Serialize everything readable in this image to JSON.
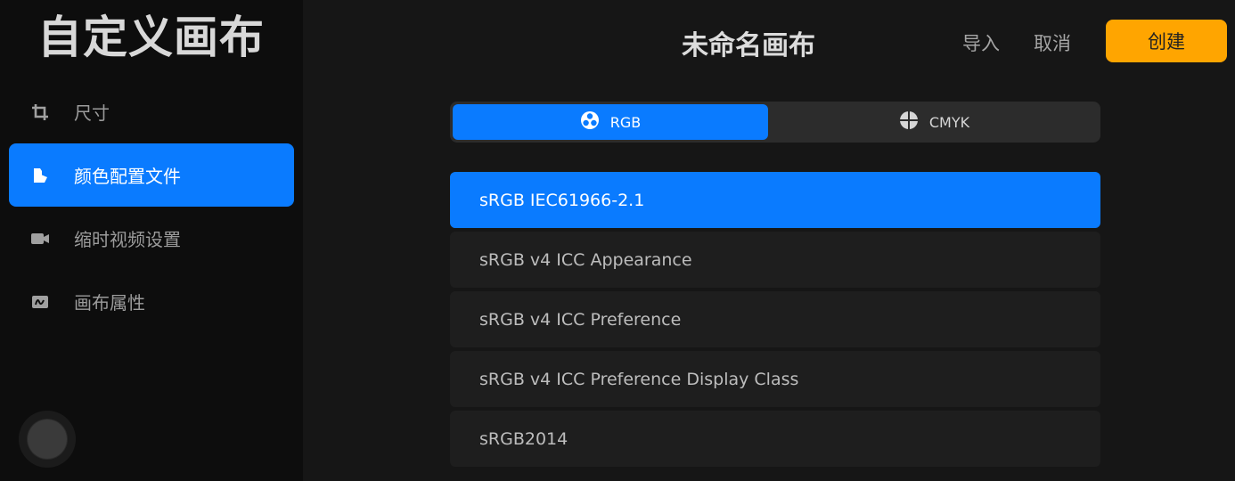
{
  "sidebar": {
    "title": "自定义画布",
    "items": [
      {
        "label": "尺寸",
        "icon": "crop-icon",
        "active": false
      },
      {
        "label": "颜色配置文件",
        "icon": "color-profile-icon",
        "active": true
      },
      {
        "label": "缩时视频设置",
        "icon": "video-camera-icon",
        "active": false
      },
      {
        "label": "画布属性",
        "icon": "canvas-properties-icon",
        "active": false
      }
    ]
  },
  "header": {
    "canvas_title": "未命名画布",
    "import_label": "导入",
    "cancel_label": "取消",
    "create_label": "创建"
  },
  "color_mode": {
    "selected": "RGB",
    "options": [
      {
        "label": "RGB",
        "icon": "rgb-icon"
      },
      {
        "label": "CMYK",
        "icon": "cmyk-icon"
      }
    ]
  },
  "profiles": {
    "selected_index": 0,
    "items": [
      "sRGB IEC61966-2.1",
      "sRGB v4 ICC Appearance",
      "sRGB v4 ICC Preference",
      "sRGB v4 ICC Preference Display Class",
      "sRGB2014"
    ]
  },
  "colors": {
    "accent": "#0a7bff",
    "create_button": "#ffa500",
    "sidebar_bg": "#0d0d0d",
    "main_bg": "#161616"
  }
}
